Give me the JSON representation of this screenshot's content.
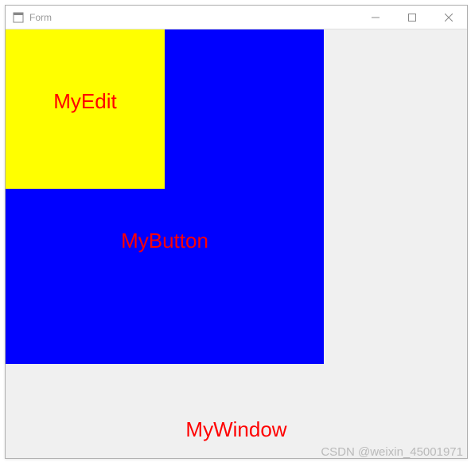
{
  "titlebar": {
    "title": "Form"
  },
  "widgets": {
    "window_label": "MyWindow",
    "button_label": "MyButton",
    "edit_label": "MyEdit"
  },
  "colors": {
    "window_bg": "#f0f0f0",
    "button_bg": "#0000ff",
    "edit_bg": "#ffff00",
    "text_color": "#ff0000"
  },
  "watermark": "CSDN @weixin_45001971"
}
